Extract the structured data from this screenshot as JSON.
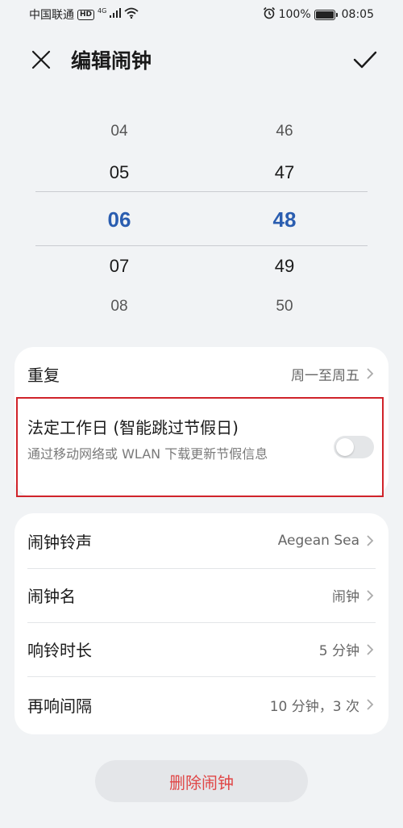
{
  "status_bar": {
    "carrier": "中国联通",
    "hd_badge": "HD",
    "network_type": "4G",
    "battery_text": "100%",
    "time": "08:05",
    "icons": [
      "signal-icon",
      "wifi-icon",
      "alarm-icon",
      "battery-icon"
    ]
  },
  "header": {
    "title": "编辑闹钟",
    "close_icon": "close-icon",
    "confirm_icon": "checkmark-icon"
  },
  "picker": {
    "hours": [
      "04",
      "05",
      "06",
      "07",
      "08"
    ],
    "minutes": [
      "46",
      "47",
      "48",
      "49",
      "50"
    ],
    "selected_hour": "06",
    "selected_minute": "48",
    "accent_color": "#2a5db0"
  },
  "settings_group1": {
    "repeat": {
      "label": "重复",
      "value": "周一至周五"
    },
    "holiday": {
      "title": "法定工作日 (智能跳过节假日)",
      "description": "通过移动网络或 WLAN 下载更新节假信息",
      "enabled": false
    }
  },
  "settings_group2": {
    "items": [
      {
        "label": "闹钟铃声",
        "value": "Aegean Sea"
      },
      {
        "label": "闹钟名",
        "value": "闹钟"
      },
      {
        "label": "响铃时长",
        "value": "5 分钟"
      },
      {
        "label": "再响间隔",
        "value": "10 分钟，3 次"
      }
    ]
  },
  "delete_button": {
    "label": "删除闹钟",
    "color": "#e04646"
  },
  "highlight_color": "#d0232a"
}
